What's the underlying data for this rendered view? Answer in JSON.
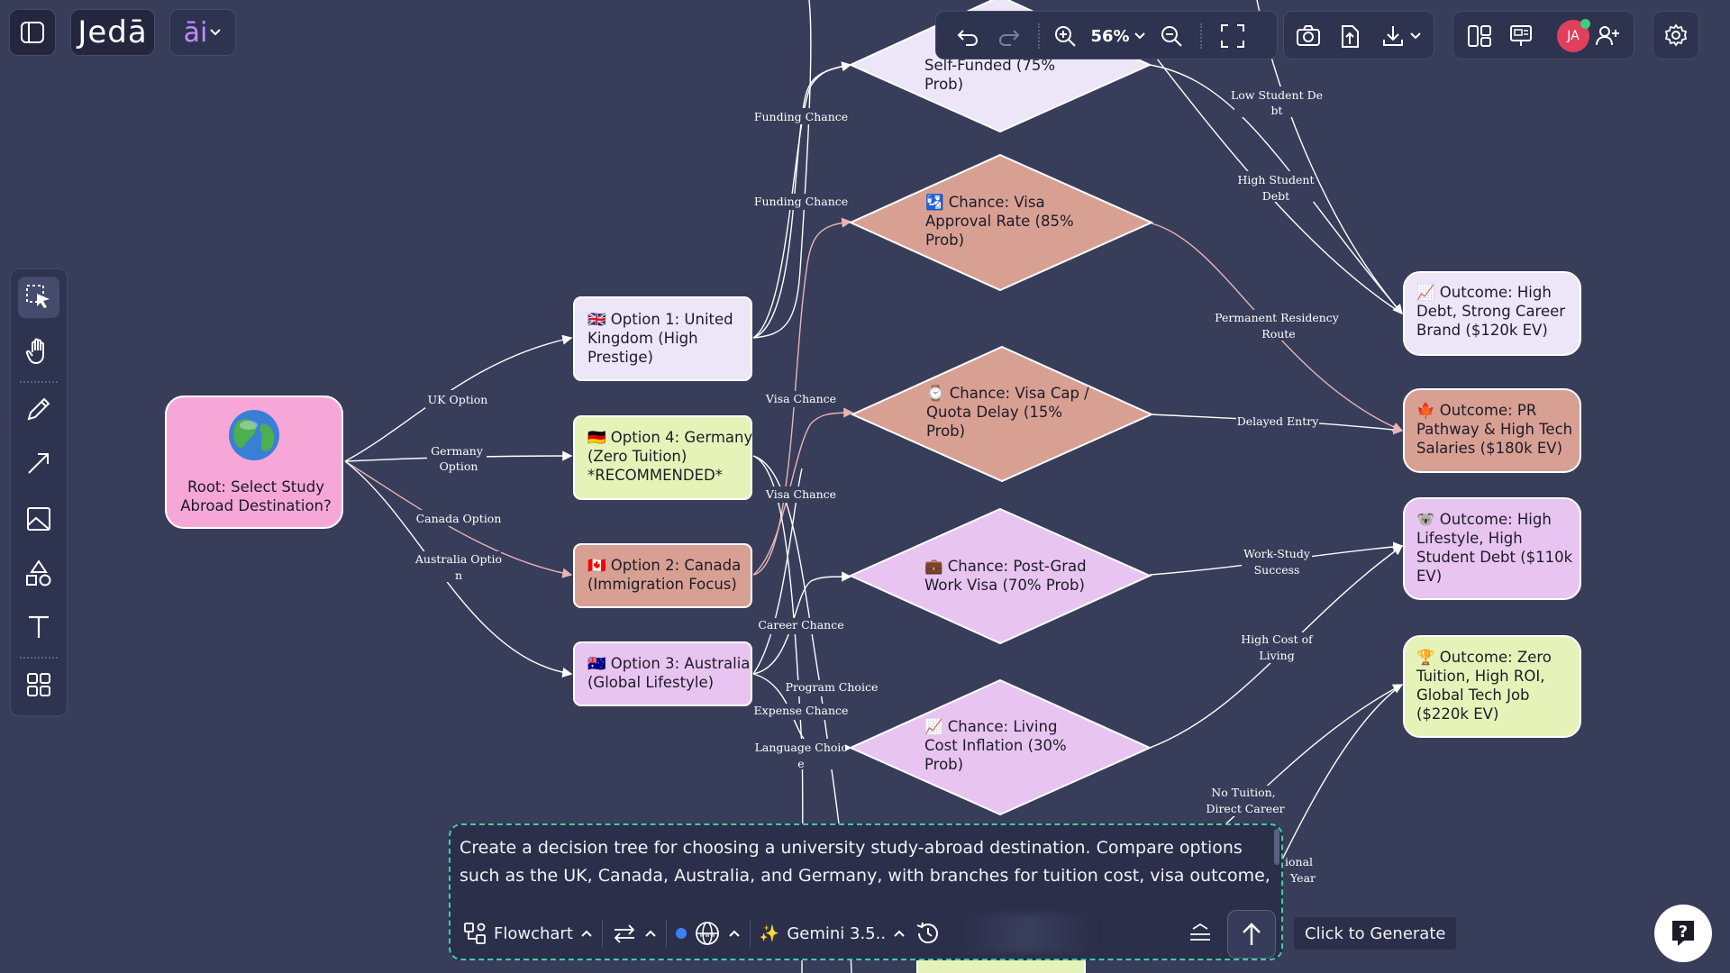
{
  "app": {
    "name": "Jedā",
    "ai_label": "āi"
  },
  "toolbar": {
    "zoom": "56%"
  },
  "user": {
    "initials": "JA"
  },
  "nodes": {
    "root": "Root: Select Study Abroad Destination?",
    "uk": [
      "🇬🇧 Option 1: United",
      "Kingdom (High",
      "Prestige)"
    ],
    "germany": [
      "🇩🇪 Option 4: Germany",
      "(Zero Tuition)",
      "*RECOMMENDED*"
    ],
    "canada": [
      "🇨🇦 Option 2: Canada",
      "(Immigration Focus)"
    ],
    "australia": [
      "🇦🇺 Option 3: Australia",
      "(Global Lifestyle)"
    ],
    "self_funded": [
      "Self-Funded (75%",
      "Prob)"
    ],
    "visa_approval": [
      "🛂 Chance: Visa",
      "Approval Rate (85%",
      "Prob)"
    ],
    "visa_cap": [
      "⌚ Chance: Visa Cap /",
      "Quota Delay (15%",
      "Prob)"
    ],
    "post_grad": [
      "💼 Chance: Post-Grad",
      "Work Visa (70% Prob)"
    ],
    "living_cost": [
      "📈 Chance: Living",
      "Cost Inflation (30%",
      "Prob)"
    ],
    "out_debt": [
      "📈 Outcome: High",
      "Debt, Strong Career",
      "Brand ($120k EV)"
    ],
    "out_pr": [
      "🍁 Outcome: PR",
      "Pathway & High Tech",
      "Salaries ($180k EV)"
    ],
    "out_lifestyle": [
      "🐨 Outcome: High",
      "Lifestyle, High",
      "Student Debt ($110k",
      "EV)"
    ],
    "out_zero": [
      "🏆 Outcome: Zero",
      "Tuition, High ROI,",
      "Global Tech Job",
      "($220k EV)"
    ]
  },
  "edge_labels": {
    "uk_option": "UK Option",
    "germany_option": [
      "Germany",
      "Option"
    ],
    "canada_option": "Canada Option",
    "australia_option": [
      "Australia Optio",
      "n"
    ],
    "funding_chance_1": "Funding Chance",
    "funding_chance_2": "Funding Chance",
    "visa_chance_1": "Visa Chance",
    "visa_chance_2": "Visa Chance",
    "career_chance": "Career Chance",
    "program_choice": "Program Choice",
    "expense_chance": "Expense Chance",
    "language_choice": [
      "Language Choic",
      "e"
    ],
    "low_student_debt": [
      "Low Student De",
      "bt"
    ],
    "high_student_debt": [
      "High Student",
      "Debt"
    ],
    "permanent_residency": [
      "Permanent Residency",
      "Route"
    ],
    "delayed_entry": "Delayed Entry",
    "work_study": [
      "Work-Study",
      "Success"
    ],
    "high_cost": [
      "High Cost of",
      "Living"
    ],
    "no_tuition": [
      "No Tuition,",
      "Direct Career"
    ],
    "partial_1": "ional",
    "partial_2": "Year"
  },
  "prompt": {
    "text": "Create a decision tree for choosing a university study-abroad destination. Compare options such as the UK, Canada, Australia, and Germany, with branches for tuition cost, visa outcome,"
  },
  "bottom_bar": {
    "mode": "Flowchart",
    "model": "Gemini 3.5.."
  },
  "tooltip": "Click to Generate",
  "colors": {
    "background": "#383d5a",
    "pink": "#f6a7d8",
    "lavender": "#ece6f8",
    "green": "#e6f3b8",
    "salmon": "#d8a093",
    "violet": "#e8c4f0",
    "accent": "#3ad0a0"
  }
}
